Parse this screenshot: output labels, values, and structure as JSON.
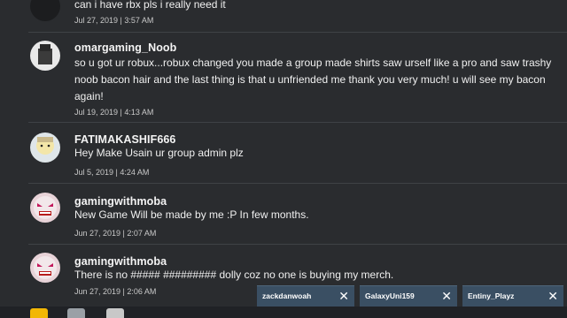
{
  "comments": [
    {
      "username": "",
      "body": "can i have rbx pls i really need it",
      "date": "Jul 27, 2019 | 3:57 AM"
    },
    {
      "username": "omargaming_Noob",
      "body": "so u got ur robux...robux changed you made a group made shirts saw urself like a pro and saw trashy noob bacon hair and the last thing is that u unfriended me thank you very much! u will see my bacon again!",
      "date": "Jul 19, 2019 | 4:13 AM"
    },
    {
      "username": "FATIMAKASHIF666",
      "body": "Hey Make Usain ur group admin plz",
      "date": "Jul 5, 2019 | 4:24 AM"
    },
    {
      "username": "gamingwithmoba",
      "body": "New Game Will be made by me :P In few months.",
      "date": "Jun 27, 2019 | 2:07 AM"
    },
    {
      "username": "gamingwithmoba",
      "body": "There is no ##### ######### dolly coz no one is buying my merch.",
      "date": "Jun 27, 2019 | 2:06 AM"
    }
  ],
  "chat_tabs": [
    {
      "name": "zackdanwoah"
    },
    {
      "name": "GalaxyUni159"
    },
    {
      "name": "Entiny_Playz"
    }
  ],
  "colors": {
    "background": "#2a2c2f",
    "chat_tab": "#3a4f63"
  }
}
